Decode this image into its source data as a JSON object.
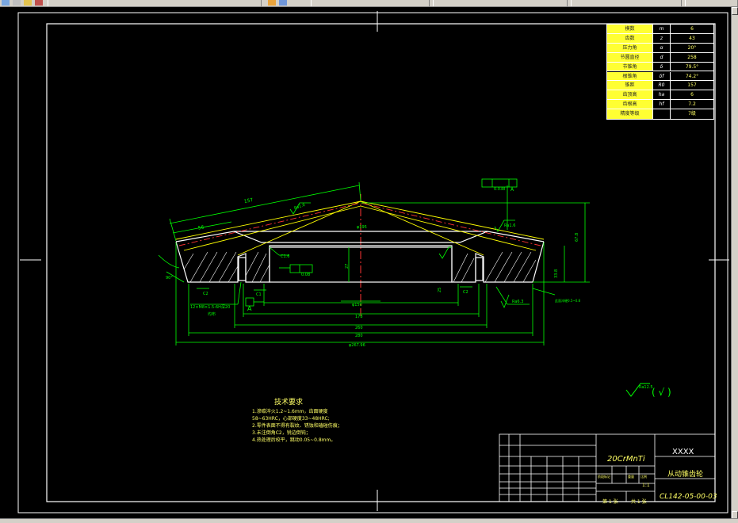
{
  "params_table": {
    "rows": [
      {
        "name": "模数",
        "sym": "m",
        "val": "6"
      },
      {
        "name": "齿数",
        "sym": "z",
        "val": "43"
      },
      {
        "name": "压力角",
        "sym": "α",
        "val": "20°"
      },
      {
        "name": "节圆直径",
        "sym": "d",
        "val": "258"
      },
      {
        "name": "节锥角",
        "sym": "δ",
        "val": "79.5°"
      },
      {
        "name": "根锥角",
        "sym": "δf",
        "val": "74.2°"
      },
      {
        "name": "锥距",
        "sym": "R0",
        "val": "157"
      },
      {
        "name": "齿顶高",
        "sym": "ha",
        "val": "6"
      },
      {
        "name": "齿根高",
        "sym": "hf",
        "val": "7.2"
      },
      {
        "name": "精度等级",
        "sym": "",
        "val": "7级"
      }
    ]
  },
  "dims": {
    "d_top_len": "157",
    "d_small": "56",
    "d_roughA": "Ra1.6",
    "d_roughB": "Ra1.6",
    "d_roughC": "Ra6.3",
    "d_c1": "C1.6",
    "d_c2": "C2",
    "d_c3": "C2",
    "d_c4": "C1",
    "d_flat": "0.08",
    "d_tol_box": "0.038",
    "d_tol_ref": "A",
    "d_datum": "A",
    "d_bore": "φ150",
    "d_178": "178",
    "d_260": "260",
    "d_280": "280",
    "d_outer": "φ267.96",
    "d_right_h": "67.8",
    "d_right_h2": "33.8",
    "d_thread": "12×M8×1.5-6H深20",
    "d_thread2": "均布",
    "d_angle": "90°",
    "d_25": "25",
    "d_27": "27",
    "d_side_note": "此面淬硬0.5~0.8",
    "d_hidden": "φ195"
  },
  "notes": {
    "title": "技术要求",
    "lines": [
      "1.渗碳淬火1.2~1.6mm，齿面硬度",
      "  58~63HRC，心部硬度33~48HRC;",
      "2.零件表面不得有裂纹、锈蚀和磕碰伤痕；",
      "3.未注倒角C2，锐边倒钝；",
      "4.热处理后校平，跳动0.05~0.8mm。"
    ]
  },
  "roughness_general": {
    "sym": "Ra12.5",
    "paren": "( √ )"
  },
  "title_block": {
    "material": "20CrMnTi",
    "company": "XXXX",
    "part_name": "从动锥齿轮",
    "drawing_no": "CL142-05-00-03",
    "scale": "1:1",
    "sheet_a": "第 1 张",
    "sheet_b": "共 1 张",
    "stage_a": "阶段标记",
    "stage_b": "重量",
    "stage_c": "比例"
  },
  "colors": {
    "frame": "#ffffff",
    "dim": "#00ff00",
    "section": "#ffffff",
    "cone": "#ffff00",
    "center": "#ff0000",
    "table_bg": "#ffff33",
    "cursor": "#ffffff"
  }
}
